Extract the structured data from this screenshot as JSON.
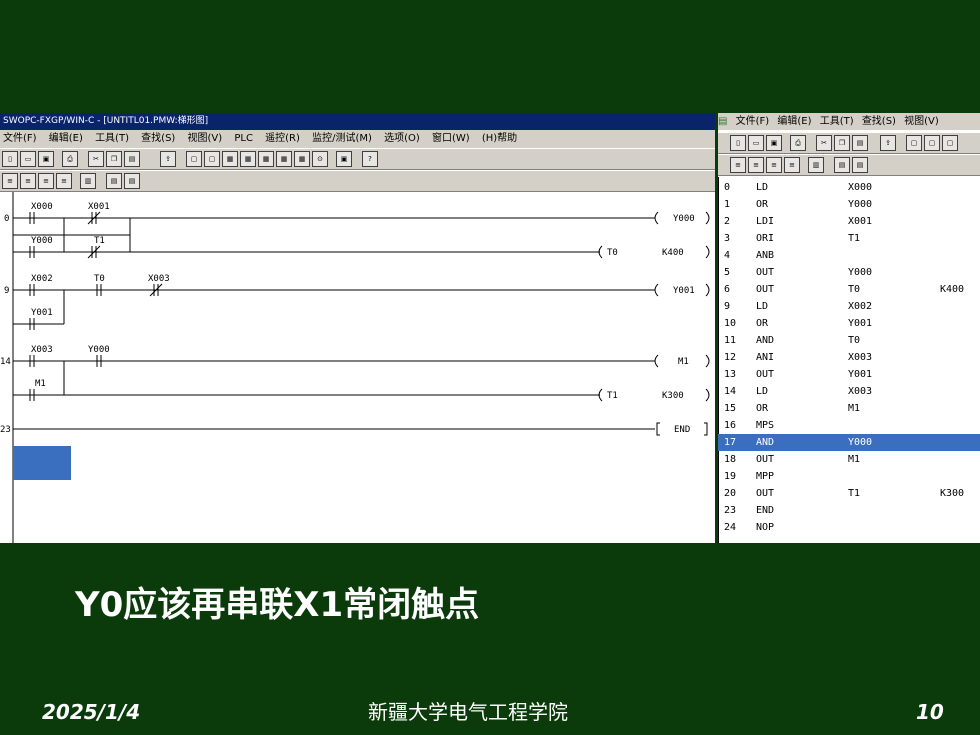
{
  "ladder_window": {
    "title": "SWOPC-FXGP/WIN-C - [UNTITL01.PMW:梯形图]",
    "menu": [
      "文件(F)",
      "编辑(E)",
      "工具(T)",
      "查找(S)",
      "视图(V)",
      "PLC",
      "遥控(R)",
      "监控/测试(M)",
      "选项(O)",
      "窗口(W)",
      "(H)帮助"
    ],
    "step_numbers": [
      "0",
      "9",
      "14",
      "23"
    ],
    "contacts": {
      "x000": "X000",
      "x001": "X001",
      "y000a": "Y000",
      "t1": "T1",
      "x002": "X002",
      "t0": "T0",
      "x003a": "X003",
      "y001": "Y001",
      "x003b": "X003",
      "y000b": "Y000",
      "m1": "M1"
    },
    "coils": {
      "y000": "Y000",
      "t0": "T0",
      "k400": "K400",
      "y001": "Y001",
      "m1": "M1",
      "t1": "T1",
      "k300": "K300",
      "end": "END"
    }
  },
  "il_window": {
    "menu": [
      "文件(F)",
      "编辑(E)",
      "工具(T)",
      "查找(S)",
      "视图(V)"
    ],
    "rows": [
      {
        "no": "0",
        "op": "LD",
        "a1": "X000",
        "a2": ""
      },
      {
        "no": "1",
        "op": "OR",
        "a1": "Y000",
        "a2": ""
      },
      {
        "no": "2",
        "op": "LDI",
        "a1": "X001",
        "a2": ""
      },
      {
        "no": "3",
        "op": "ORI",
        "a1": "T1",
        "a2": ""
      },
      {
        "no": "4",
        "op": "ANB",
        "a1": "",
        "a2": ""
      },
      {
        "no": "5",
        "op": "OUT",
        "a1": "Y000",
        "a2": ""
      },
      {
        "no": "6",
        "op": "OUT",
        "a1": "T0",
        "a2": "K400"
      },
      {
        "no": "9",
        "op": "LD",
        "a1": "X002",
        "a2": ""
      },
      {
        "no": "10",
        "op": "OR",
        "a1": "Y001",
        "a2": ""
      },
      {
        "no": "11",
        "op": "AND",
        "a1": "T0",
        "a2": ""
      },
      {
        "no": "12",
        "op": "ANI",
        "a1": "X003",
        "a2": ""
      },
      {
        "no": "13",
        "op": "OUT",
        "a1": "Y001",
        "a2": ""
      },
      {
        "no": "14",
        "op": "LD",
        "a1": "X003",
        "a2": ""
      },
      {
        "no": "15",
        "op": "OR",
        "a1": "M1",
        "a2": ""
      },
      {
        "no": "16",
        "op": "MPS",
        "a1": "",
        "a2": ""
      },
      {
        "no": "17",
        "op": "AND",
        "a1": "Y000",
        "a2": ""
      },
      {
        "no": "18",
        "op": "OUT",
        "a1": "M1",
        "a2": ""
      },
      {
        "no": "19",
        "op": "MPP",
        "a1": "",
        "a2": ""
      },
      {
        "no": "20",
        "op": "OUT",
        "a1": "T1",
        "a2": "K300"
      },
      {
        "no": "23",
        "op": "END",
        "a1": "",
        "a2": ""
      },
      {
        "no": "24",
        "op": "NOP",
        "a1": "",
        "a2": ""
      }
    ],
    "selected_row": 15
  },
  "caption": "Y0应该再串联X1常闭触点",
  "footer": {
    "date": "2025/1/4",
    "school": "新疆大学电气工程学院",
    "page": "10"
  },
  "colors": {
    "background": "#0b3a0b",
    "title_bar": "#0a246a",
    "selection": "#3a6fc0",
    "toolbar": "#d4d0c8"
  }
}
